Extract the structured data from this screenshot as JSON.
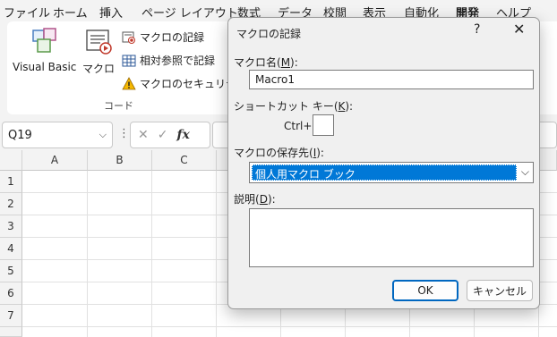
{
  "menu": {
    "items": [
      "ファイル",
      "ホーム",
      "挿入",
      "ページ レイアウト",
      "数式",
      "データ",
      "校閲",
      "表示",
      "自動化",
      "開発",
      "ヘルプ"
    ],
    "active": "開発"
  },
  "ribbon": {
    "visual_basic_label": "Visual Basic",
    "macro_label": "マクロ",
    "record_macro_label": "マクロの記録",
    "relative_ref_label": "相対参照で記録",
    "macro_security_label": "マクロのセキュリティ",
    "group_label": "コード"
  },
  "formula_bar": {
    "name_box": "Q19",
    "cancel_glyph": "✕",
    "enter_glyph": "✓",
    "fx_glyph": "fx",
    "formula_value": ""
  },
  "grid": {
    "columns": [
      "A",
      "B",
      "C"
    ],
    "rows": [
      "1",
      "2",
      "3",
      "4",
      "5",
      "6",
      "7"
    ]
  },
  "dialog": {
    "title": "マクロの記録",
    "help": "?",
    "close": "✕",
    "macro_name_label": "マクロ名(",
    "macro_name_key": "M",
    "macro_name_label_end": "):",
    "macro_name_value": "Macro1",
    "shortcut_label": "ショートカット キー(",
    "shortcut_key": "K",
    "shortcut_label_end": "):",
    "ctrl_label": "Ctrl+",
    "shortcut_value": "",
    "store_label": "マクロの保存先(",
    "store_key": "I",
    "store_label_end": "):",
    "store_value": "個人用マクロ ブック",
    "desc_label": "説明(",
    "desc_key": "D",
    "desc_label_end": "):",
    "desc_value": "",
    "ok_label": "OK",
    "cancel_label": "キャンセル"
  }
}
